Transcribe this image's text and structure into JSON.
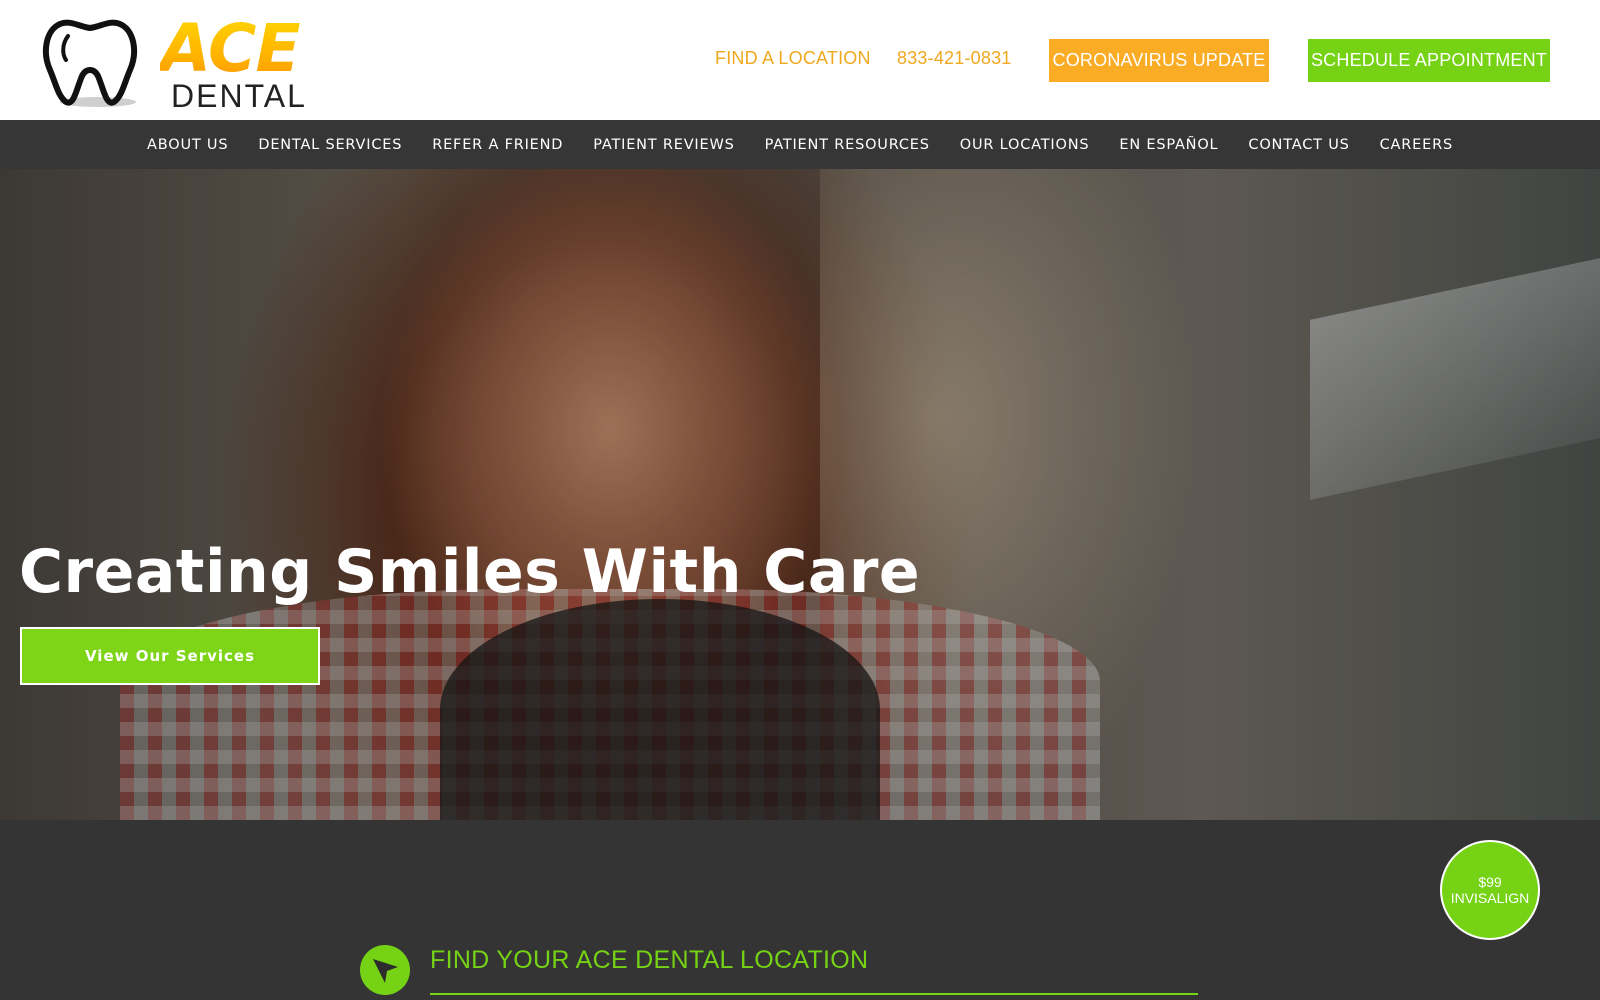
{
  "brand": {
    "logo_word_1": "ACE",
    "logo_word_2": "DENTAL",
    "icon": "tooth-icon"
  },
  "header": {
    "find_location": "FIND A LOCATION",
    "phone": "833-421-0831",
    "coronavirus_button": "CORONAVIRUS UPDATE",
    "schedule_button": "SCHEDULE APPOINTMENT"
  },
  "nav": {
    "items": [
      "ABOUT US",
      "DENTAL SERVICES",
      "REFER A FRIEND",
      "PATIENT REVIEWS",
      "PATIENT RESOURCES",
      "OUR LOCATIONS",
      "EN ESPAÑOL",
      "CONTACT US",
      "CAREERS"
    ]
  },
  "hero": {
    "title": "Creating Smiles With Care",
    "cta": "View Our Services"
  },
  "promo": {
    "line_1": "$99",
    "line_2": "INVISALIGN"
  },
  "locations": {
    "title": "FIND YOUR ACE DENTAL LOCATION",
    "icon": "location-arrow-icon"
  },
  "colors": {
    "orange": "#fbac25",
    "green": "#76d215",
    "nav_bg": "#363636",
    "section_bg": "#343434"
  }
}
